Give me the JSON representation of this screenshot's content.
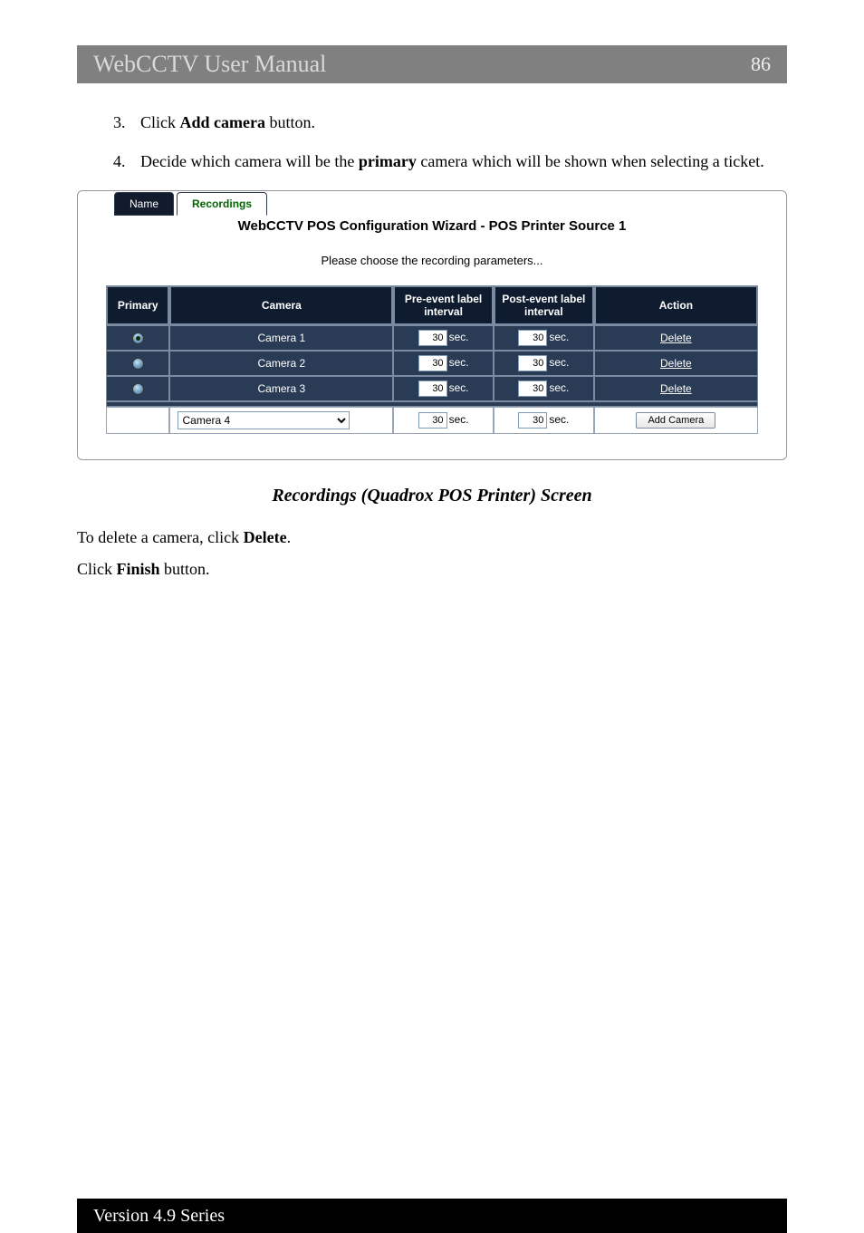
{
  "header": {
    "title": "WebCCTV User Manual",
    "page": "86"
  },
  "steps": {
    "s3": {
      "num": "3.",
      "pre": "Click ",
      "bold": "Add camera",
      "post": " button."
    },
    "s4": {
      "num": "4.",
      "pre": "Decide which camera will be the ",
      "bold": "primary",
      "post": " camera which will be shown when selecting a ticket."
    }
  },
  "figure": {
    "tab_name": "Name",
    "tab_recordings": "Recordings",
    "title": "WebCCTV POS Configuration Wizard - POS Printer Source 1",
    "subtitle": "Please choose the recording parameters...",
    "headers": {
      "primary": "Primary",
      "camera": "Camera",
      "pre": "Pre-event label interval",
      "post": "Post-event label interval",
      "action": "Action"
    },
    "rows": [
      {
        "camera": "Camera 1",
        "pre": "30",
        "post": "30",
        "action": "Delete",
        "selected": true
      },
      {
        "camera": "Camera 2",
        "pre": "30",
        "post": "30",
        "action": "Delete",
        "selected": false
      },
      {
        "camera": "Camera 3",
        "pre": "30",
        "post": "30",
        "action": "Delete",
        "selected": false
      }
    ],
    "unit": "sec.",
    "add": {
      "camera": "Camera 4",
      "pre": "30",
      "post": "30",
      "button": "Add Camera"
    }
  },
  "caption": "Recordings (Quadrox POS Printer) Screen",
  "p1": {
    "pre": "To delete a camera, click ",
    "bold": "Delete",
    "post": "."
  },
  "p2": {
    "pre": "Click ",
    "bold": "Finish",
    "post": " button."
  },
  "footer": "Version 4.9 Series"
}
